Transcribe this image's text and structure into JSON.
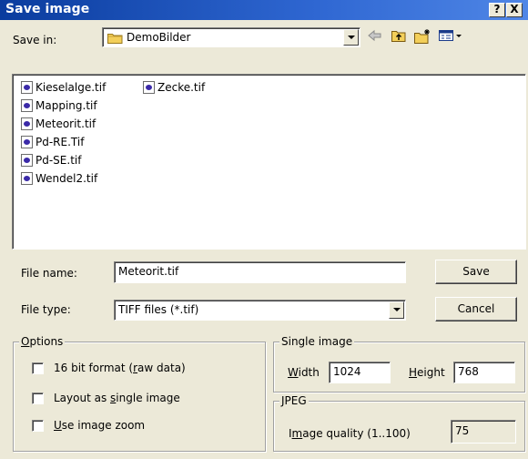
{
  "window": {
    "title": "Save image",
    "help_label": "?",
    "close_label": "X"
  },
  "save_in": {
    "label": "Save in:",
    "value": "DemoBilder"
  },
  "files": [
    "Kieselalge.tif",
    "Mapping.tif",
    "Meteorit.tif",
    "Pd-RE.Tif",
    "Pd-SE.tif",
    "Wendel2.tif",
    "Zecke.tif"
  ],
  "file_name": {
    "label": "File name:",
    "value": "Meteorit.tif"
  },
  "file_type": {
    "label": "File type:",
    "value": "TIFF files (*.tif)"
  },
  "buttons": {
    "save": "Save",
    "cancel": "Cancel"
  },
  "options": {
    "label_mnemonic": "O",
    "label_rest": "ptions",
    "bit16_pre": "16 bit format (",
    "bit16_mn": "r",
    "bit16_post": "aw data)",
    "layout_pre": "Layout as ",
    "layout_mn": "s",
    "layout_post": "ingle image",
    "zoom_mn": "U",
    "zoom_post": "se image zoom",
    "bit16_checked": false,
    "layout_checked": false,
    "zoom_checked": false
  },
  "single_image": {
    "label": "Single image",
    "width_mn": "W",
    "width_rest": "idth",
    "width_value": "1024",
    "height_mn": "H",
    "height_rest": "eight",
    "height_value": "768"
  },
  "jpeg": {
    "label": "JPEG",
    "quality_pre": "I",
    "quality_mn": "m",
    "quality_post": "age quality (1..100)",
    "quality_value": "75"
  },
  "colors": {
    "title_bar": "#2f67d2",
    "dialog_bg": "#ece9d8",
    "folder_yellow": "#f0c040"
  }
}
